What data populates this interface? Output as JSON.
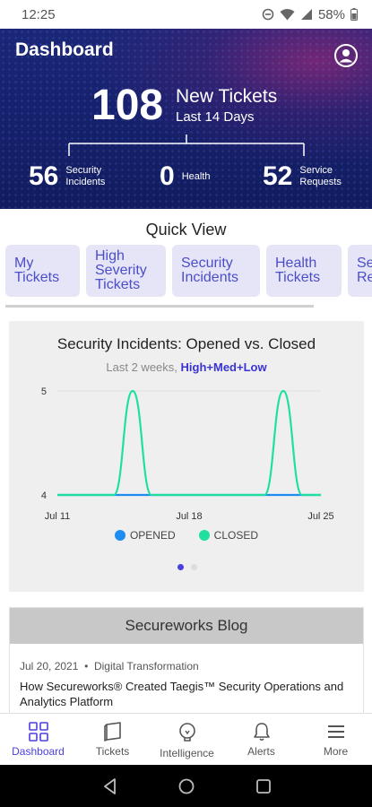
{
  "status_bar": {
    "time": "12:25",
    "battery": "58%",
    "icons": [
      "dnd-icon",
      "wifi-icon",
      "signal-icon",
      "battery-icon"
    ]
  },
  "header": {
    "title": "Dashboard",
    "new_tickets_count": "108",
    "new_tickets_label": "New Tickets",
    "period_label": "Last 14 Days",
    "stats": [
      {
        "value": "56",
        "label_line1": "Security",
        "label_line2": "Incidents"
      },
      {
        "value": "0",
        "label_line1": "Health",
        "label_line2": ""
      },
      {
        "value": "52",
        "label_line1": "Service",
        "label_line2": "Requests"
      }
    ]
  },
  "quick_view": {
    "title": "Quick View",
    "chips": [
      {
        "line1": "My",
        "line2": "Tickets",
        "line3": ""
      },
      {
        "line1": "High",
        "line2": "Severity",
        "line3": "Tickets"
      },
      {
        "line1": "Security",
        "line2": "Incidents",
        "line3": ""
      },
      {
        "line1": "Health",
        "line2": "Tickets",
        "line3": ""
      },
      {
        "line1": "Se",
        "line2": "Re",
        "line3": ""
      }
    ]
  },
  "chart_card": {
    "title": "Security Incidents: Opened vs. Closed",
    "subtitle_prefix": "Last 2 weeks, ",
    "subtitle_filter": "High+Med+Low",
    "pager": {
      "pages": 2,
      "active": 0
    }
  },
  "chart_data": {
    "type": "line",
    "x": [
      "Jul 11",
      "Jul 12",
      "Jul 13",
      "Jul 14",
      "Jul 15",
      "Jul 16",
      "Jul 17",
      "Jul 18",
      "Jul 19",
      "Jul 20",
      "Jul 21",
      "Jul 22",
      "Jul 23",
      "Jul 24",
      "Jul 25"
    ],
    "x_tick_labels": [
      "Jul 11",
      "Jul 18",
      "Jul 25"
    ],
    "y_tick_labels": [
      "4",
      "5"
    ],
    "ylim": [
      4,
      5
    ],
    "series": [
      {
        "name": "OPENED",
        "color": "#1e8cf0",
        "values": [
          4,
          4,
          4,
          4,
          4,
          4,
          4,
          4,
          4,
          4,
          4,
          4,
          4,
          4,
          4
        ]
      },
      {
        "name": "CLOSED",
        "color": "#1fe0a0",
        "values": [
          4,
          4,
          4,
          4,
          5,
          4,
          4,
          4,
          4,
          4,
          4,
          4,
          5,
          4,
          4
        ]
      }
    ],
    "legend_position": "bottom",
    "grid": true
  },
  "blog": {
    "header": "Secureworks Blog",
    "date": "Jul 20, 2021",
    "category": "Digital Transformation",
    "title": "How Secureworks® Created Taegis™ Security Operations and Analytics Platform"
  },
  "bottom_nav": {
    "items": [
      {
        "label": "Dashboard",
        "icon": "dashboard-icon",
        "active": true
      },
      {
        "label": "Tickets",
        "icon": "tickets-icon",
        "active": false
      },
      {
        "label": "Intelligence",
        "icon": "lightbulb-icon",
        "active": false
      },
      {
        "label": "Alerts",
        "icon": "bell-icon",
        "active": false
      },
      {
        "label": "More",
        "icon": "menu-icon",
        "active": false
      }
    ]
  },
  "colors": {
    "brand_navy": "#1b2777",
    "accent": "#4b3fe0",
    "chip_bg": "#e6e5f8"
  }
}
